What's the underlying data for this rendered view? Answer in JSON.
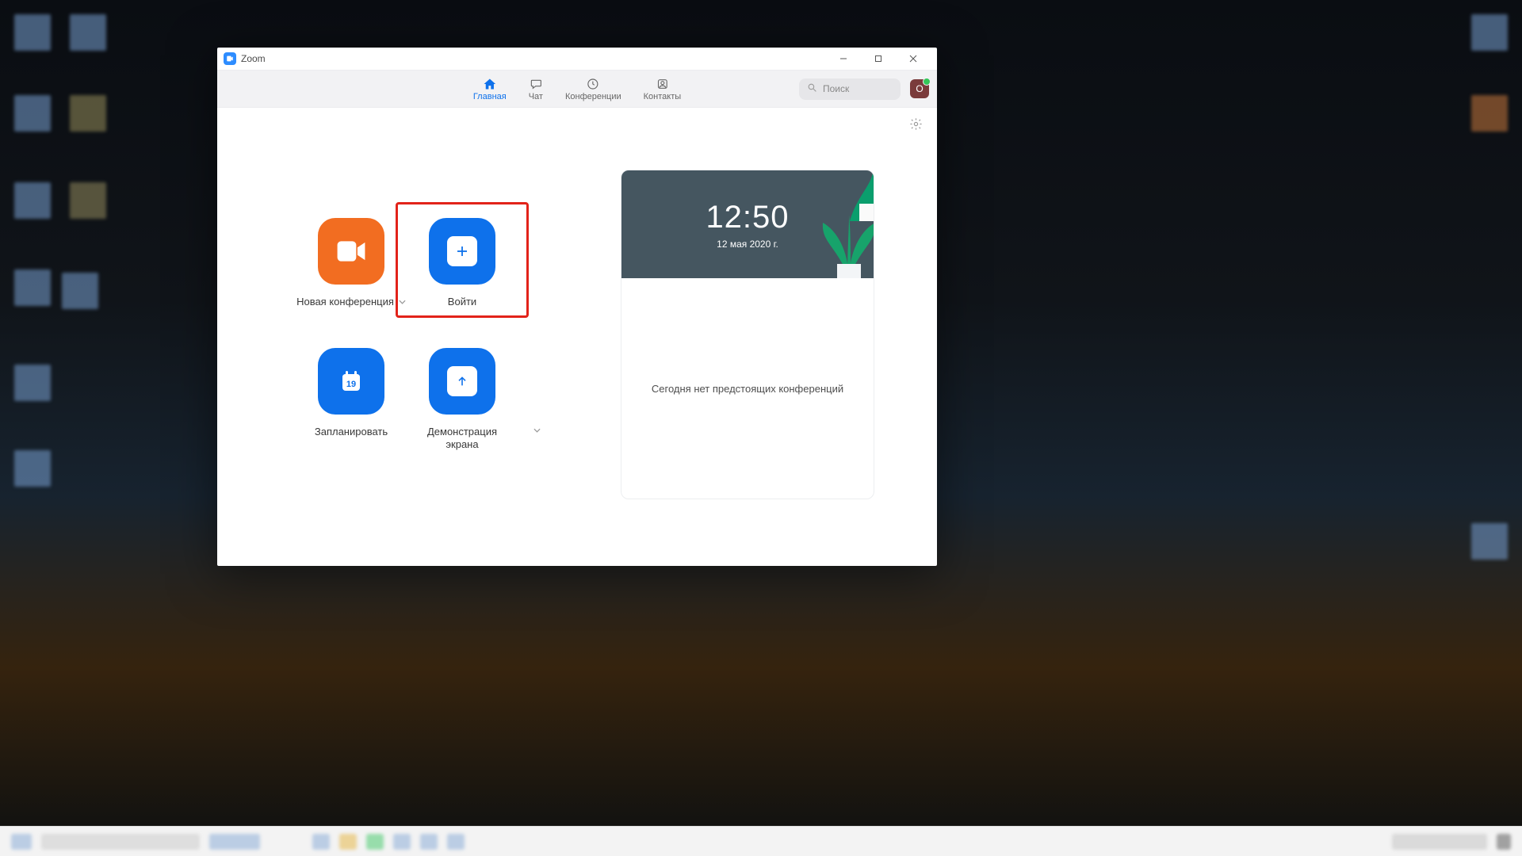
{
  "window": {
    "title": "Zoom",
    "controls": {
      "min": "–",
      "max": "▢",
      "close": "✕"
    }
  },
  "tabs": {
    "home": "Главная",
    "chat": "Чат",
    "meetings": "Конференции",
    "contacts": "Контакты"
  },
  "search": {
    "placeholder": "Поиск"
  },
  "avatar_letter": "O",
  "buttons": {
    "new_meeting": "Новая конференция",
    "join": "Войти",
    "schedule": "Запланировать",
    "schedule_day": "19",
    "share": "Демонстрация экрана"
  },
  "info": {
    "time": "12:50",
    "date": "12 мая 2020 г.",
    "no_meetings": "Сегодня нет предстоящих конференций"
  }
}
